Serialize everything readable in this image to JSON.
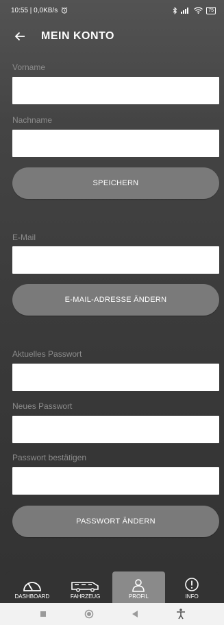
{
  "status_bar": {
    "time_speed": "10:55 | 0,0KB/s",
    "battery": "75"
  },
  "header": {
    "title": "MEIN KONTO"
  },
  "form": {
    "vorname_label": "Vorname",
    "vorname_value": "",
    "nachname_label": "Nachname",
    "nachname_value": "",
    "save_button": "SPEICHERN",
    "email_label": "E-Mail",
    "email_value": "",
    "email_button": "E-MAIL-ADRESSE ÄNDERN",
    "current_password_label": "Aktuelles Passwort",
    "new_password_label": "Neues Passwort",
    "confirm_password_label": "Passwort bestätigen",
    "password_button": "PASSWORT ÄNDERN"
  },
  "bottom_nav": {
    "items": [
      {
        "label": "DASHBOARD",
        "icon": "dashboard-gauge-icon"
      },
      {
        "label": "FAHRZEUG",
        "icon": "camper-van-icon"
      },
      {
        "label": "PROFIL",
        "icon": "person-icon",
        "active": true
      },
      {
        "label": "INFO",
        "icon": "info-icon"
      }
    ]
  },
  "colors": {
    "background": "#444444",
    "button": "#7a7a7a",
    "label": "#8c8c8c",
    "nav_active": "#8a8a8a"
  }
}
